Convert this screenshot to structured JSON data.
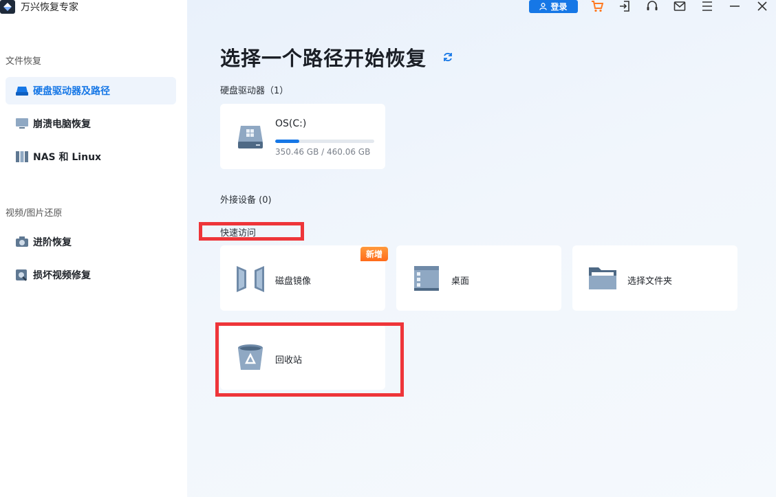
{
  "app": {
    "name": "万兴恢复专家"
  },
  "sidebar": {
    "section1": "文件恢复",
    "section2": "视频/图片还原",
    "items": [
      {
        "label": "硬盘驱动器及路径",
        "icon": "drive-icon",
        "active": true
      },
      {
        "label": "崩溃电脑恢复",
        "icon": "monitor-icon"
      },
      {
        "label": "NAS 和 Linux",
        "icon": "nas-icon"
      },
      {
        "label": "进阶恢复",
        "icon": "camera-icon"
      },
      {
        "label": "损坏视频修复",
        "icon": "video-repair-icon"
      }
    ]
  },
  "toolbar": {
    "login_label": "登录",
    "icons": [
      "cart-icon",
      "sign-in-icon",
      "headset-icon",
      "mail-icon",
      "menu-icon",
      "minimize-icon",
      "close-icon"
    ]
  },
  "main": {
    "title": "选择一个路径开始恢复",
    "hard_drives_label": "硬盘驱动器（1）",
    "drives": [
      {
        "name": "OS(C:)",
        "size_text": "350.46 GB / 460.06 GB",
        "used_fraction": 0.24
      }
    ],
    "external_label": "外接设备 (0)",
    "quick_access_label": "快速访问",
    "quick_access": [
      {
        "label": "磁盘镜像",
        "icon": "disk-image-icon",
        "badge": "新增"
      },
      {
        "label": "桌面",
        "icon": "desktop-icon"
      },
      {
        "label": "选择文件夹",
        "icon": "folder-icon"
      },
      {
        "label": "回收站",
        "icon": "recycle-bin-icon"
      }
    ]
  },
  "colors": {
    "accent": "#1677e6",
    "highlight": "#ee3539",
    "badge": "#ff7a22"
  }
}
